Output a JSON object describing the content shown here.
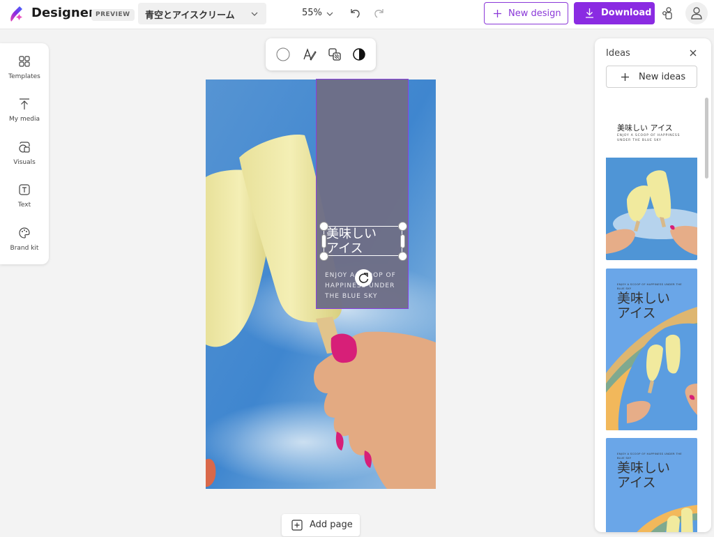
{
  "app": {
    "name": "Designer",
    "badge": "PREVIEW",
    "document_title": "青空とアイスクリーム",
    "zoom": "55%",
    "new_design_label": "New design",
    "download_label": "Download",
    "accent_color": "#8a2be2"
  },
  "left_rail": {
    "items": [
      {
        "label": "Templates",
        "icon": "templates-icon"
      },
      {
        "label": "My media",
        "icon": "upload-icon"
      },
      {
        "label": "Visuals",
        "icon": "visuals-icon"
      },
      {
        "label": "Text",
        "icon": "text-icon"
      },
      {
        "label": "Brand kit",
        "icon": "palette-icon"
      }
    ]
  },
  "toolbar": {
    "tools": [
      "fill-color-icon",
      "text-effects-icon",
      "arrange-icon",
      "contrast-icon"
    ]
  },
  "canvas": {
    "headline": "美味しい\nアイス",
    "tagline": "ENJOY A SCOOP OF\nHAPPINESS UNDER\nTHE BLUE SKY",
    "box_color": "#6e6e86",
    "selection_color": "#8a40e0"
  },
  "add_page_label": "Add page",
  "ideas": {
    "title": "Ideas",
    "new_ideas_label": "New ideas",
    "cards": [
      {
        "headline": "美味しい アイス",
        "tagline": "ENJOY A SCOOP OF HAPPINESS\nUNDER THE BLUE SKY"
      },
      {
        "headline": "美味しい\nアイス",
        "tagline": "ENJOY A SCOOP OF HAPPINESS UNDER THE\nBLUE SKY"
      },
      {
        "headline": "美味しい\nアイス",
        "tagline": "ENJOY A SCOOP OF HAPPINESS UNDER THE\nBLUE SKY"
      }
    ]
  }
}
